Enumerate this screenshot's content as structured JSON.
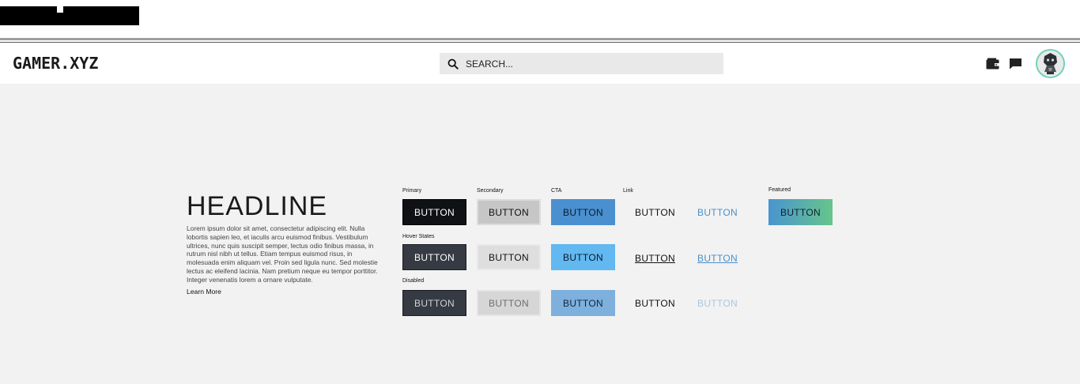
{
  "header": {
    "logo": "GAMER.XYZ",
    "search_placeholder": "SEARCH..."
  },
  "hero": {
    "headline": "HEADLINE",
    "body": "Lorem ipsum dolor sit amet, consectetur adipiscing elit. Nulla lobortis sapien leo, et iaculis arcu euismod finibus. Vestibulum ultrices, nunc quis suscipit semper, lectus odio finibus massa, in rutrum nisl nibh ut tellus. Etiam tempus euismod risus, in molesuada enim aliquam vel. Proin sed ligula nunc. Sed molestie lectus ac eleifend lacinia. Nam pretium neque eu tempor porttitor. Integer venenatis lorem a ornare vulputate.",
    "learn_more": "Learn More"
  },
  "labels": {
    "primary": "Primary",
    "secondary": "Secondary",
    "cta": "CTA",
    "link": "Link",
    "featured": "Featured",
    "hover": "Hover States",
    "disabled": "Disabled"
  },
  "button_label": "BUTTON",
  "colors": {
    "primary": "#0f1115",
    "cta": "#4a90d0",
    "cta_hover": "#62b8f0",
    "link_blue": "#4a90c8",
    "featured_start": "#4a94d0",
    "featured_end": "#66c58a",
    "avatar_ring": "#6dd2b8"
  },
  "icons": {
    "search": "search-icon",
    "wallet": "wallet-icon",
    "chat": "chat-icon",
    "avatar": "avatar"
  }
}
